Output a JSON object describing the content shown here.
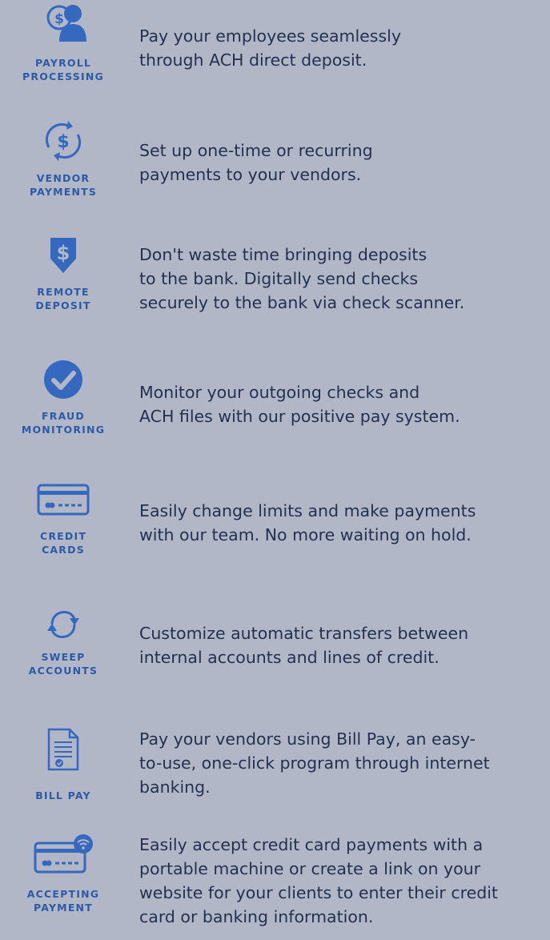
{
  "colors": {
    "background": "#b2b7c7",
    "accent": "#3568bf",
    "label": "#2c5aa6",
    "text": "#23314f"
  },
  "services": [
    {
      "icon": "payroll-icon",
      "label": "PAYROLL\nPROCESSING",
      "description": "Pay your employees seamlessly\nthrough ACH direct deposit."
    },
    {
      "icon": "vendor-payments-icon",
      "label": "VENDOR\nPAYMENTS",
      "description": "Set up one-time or recurring\npayments to your vendors."
    },
    {
      "icon": "remote-deposit-icon",
      "label": "REMOTE\nDEPOSIT",
      "description": "Don't waste time bringing deposits\nto the bank. Digitally send checks\nsecurely to the bank via check scanner."
    },
    {
      "icon": "fraud-monitoring-icon",
      "label": "FRAUD\nMONITORING",
      "description": "Monitor your outgoing checks and\nACH files with our positive pay system."
    },
    {
      "icon": "credit-card-icon",
      "label": "CREDIT\nCARDS",
      "description": "Easily change limits and make payments\nwith our team. No more waiting on hold."
    },
    {
      "icon": "sweep-accounts-icon",
      "label": "SWEEP\nACCOUNTS",
      "description": "Customize automatic transfers between\ninternal accounts and lines of credit."
    },
    {
      "icon": "bill-pay-icon",
      "label": "BILL PAY",
      "description": "Pay your vendors using Bill Pay, an easy-\nto-use, one-click program through internet\nbanking."
    },
    {
      "icon": "accepting-payment-icon",
      "label": "ACCEPTING\nPAYMENT",
      "description": "Easily accept credit card payments with a\nportable machine or create a link on your\nwebsite for your clients to enter their credit\ncard or banking information."
    }
  ]
}
